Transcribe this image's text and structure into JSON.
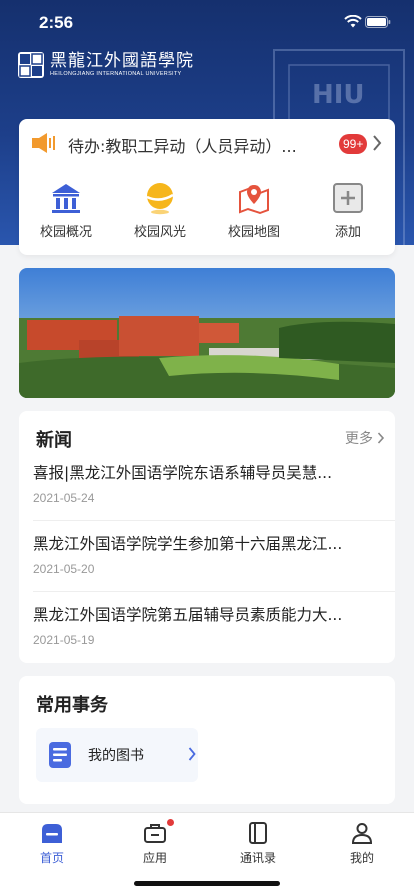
{
  "status": {
    "time": "2:56"
  },
  "header": {
    "logo_cn": "黑龍江外國語學院",
    "logo_en": "HEILONGJIANG INTERNATIONAL UNIVERSITY",
    "deco_text": "HIU"
  },
  "todo": {
    "text": "待办:教职工异动（人员异动）...",
    "badge": "99+"
  },
  "quick": [
    {
      "label": "校园概况",
      "icon": "building-icon"
    },
    {
      "label": "校园风光",
      "icon": "scenery-icon"
    },
    {
      "label": "校园地图",
      "icon": "map-pin-icon"
    },
    {
      "label": "添加",
      "icon": "add-icon"
    }
  ],
  "news": {
    "title": "新闻",
    "more": "更多",
    "items": [
      {
        "title": "喜报|黑龙江外国语学院东语系辅导员吴慧...",
        "date": "2021-05-24"
      },
      {
        "title": "黑龙江外国语学院学生参加第十六届黑龙江...",
        "date": "2021-05-20"
      },
      {
        "title": "黑龙江外国语学院第五届辅导员素质能力大...",
        "date": "2021-05-19"
      }
    ]
  },
  "services": {
    "title": "常用事务",
    "items": [
      {
        "label": "我的图书",
        "icon": "book-icon"
      }
    ]
  },
  "tabs": [
    {
      "label": "首页",
      "icon": "home-icon",
      "active": true
    },
    {
      "label": "应用",
      "icon": "briefcase-icon",
      "dot": true
    },
    {
      "label": "通讯录",
      "icon": "contacts-icon"
    },
    {
      "label": "我的",
      "icon": "user-icon"
    }
  ],
  "colors": {
    "header": "#1d3f8a",
    "accent": "#3d5fd6",
    "badge": "#e23a3a"
  }
}
